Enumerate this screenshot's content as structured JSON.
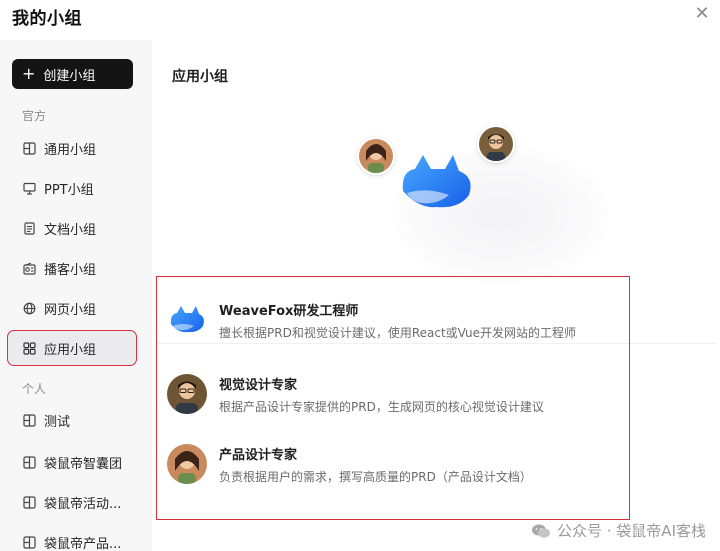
{
  "header": {
    "title": "我的小组",
    "close_glyph": "✕"
  },
  "sidebar": {
    "create_button": {
      "plus": "+",
      "label": "创建小组"
    },
    "sections": [
      {
        "label": "官方"
      },
      {
        "label": "个人"
      }
    ],
    "official_items": [
      {
        "label": "通用小组",
        "icon": "table-icon"
      },
      {
        "label": "PPT小组",
        "icon": "presentation-icon"
      },
      {
        "label": "文档小组",
        "icon": "document-icon"
      },
      {
        "label": "播客小组",
        "icon": "radio-icon"
      },
      {
        "label": "网页小组",
        "icon": "globe-icon"
      },
      {
        "label": "应用小组",
        "icon": "apps-icon",
        "active": true
      }
    ],
    "personal_items": [
      {
        "label": "测试",
        "icon": "table-icon"
      },
      {
        "label": "袋鼠帝智囊团",
        "icon": "table-icon"
      },
      {
        "label": "袋鼠帝活动...",
        "icon": "table-icon"
      },
      {
        "label": "袋鼠帝产品...",
        "icon": "table-icon"
      }
    ]
  },
  "main": {
    "title": "应用小组",
    "agents": [
      {
        "name": "WeaveFox研发工程师",
        "desc": "擅长根据PRD和视觉设计建议，使用React或Vue开发网站的工程师"
      },
      {
        "name": "视觉设计专家",
        "desc": "根据产品设计专家提供的PRD，生成网页的核心视觉设计建议"
      },
      {
        "name": "产品设计专家",
        "desc": "负责根据用户的需求，撰写高质量的PRD（产品设计文档）"
      }
    ]
  },
  "watermark": {
    "text": "公众号 · 袋鼠帝AI客栈"
  },
  "colors": {
    "accent_red": "#d8303a",
    "brand_blue": "#1e7cf2",
    "button_dark": "#141414"
  }
}
